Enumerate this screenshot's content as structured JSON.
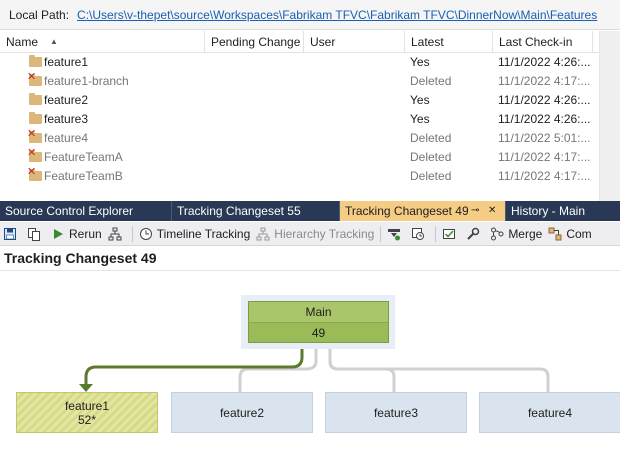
{
  "path_bar": {
    "label": "Local Path:",
    "path": "C:\\Users\\v-thepet\\source\\Workspaces\\Fabrikam TFVC\\Fabrikam TFVC\\DinnerNow\\Main\\Features"
  },
  "explorer": {
    "columns": [
      "Name",
      "Pending Change",
      "User",
      "Latest",
      "Last Check-in"
    ],
    "rows": [
      {
        "name": "feature1",
        "pending": "",
        "user": "",
        "latest": "Yes",
        "checkin": "11/1/2022 4:26:..."
      },
      {
        "name": "feature1-branch",
        "pending": "",
        "user": "",
        "latest": "Deleted",
        "checkin": "11/1/2022 4:17:..."
      },
      {
        "name": "feature2",
        "pending": "",
        "user": "",
        "latest": "Yes",
        "checkin": "11/1/2022 4:26:..."
      },
      {
        "name": "feature3",
        "pending": "",
        "user": "",
        "latest": "Yes",
        "checkin": "11/1/2022 4:26:..."
      },
      {
        "name": "feature4",
        "pending": "",
        "user": "",
        "latest": "Deleted",
        "checkin": "11/1/2022 5:01:..."
      },
      {
        "name": "FeatureTeamA",
        "pending": "",
        "user": "",
        "latest": "Deleted",
        "checkin": "11/1/2022 4:17:..."
      },
      {
        "name": "FeatureTeamB",
        "pending": "",
        "user": "",
        "latest": "Deleted",
        "checkin": "11/1/2022 4:17:..."
      }
    ]
  },
  "tabs": [
    {
      "label": "Source Control Explorer"
    },
    {
      "label": "Tracking Changeset 55"
    },
    {
      "label": "Tracking Changeset 49",
      "pin": "⊸",
      "close": "✕"
    },
    {
      "label": "History - Main"
    }
  ],
  "toolbar": {
    "rerun": "Rerun",
    "timeline": "Timeline Tracking",
    "hierarchy": "Hierarchy Tracking",
    "merge": "Merge",
    "compare": "Com"
  },
  "heading": "Tracking Changeset 49",
  "diagram": {
    "main": {
      "name": "Main",
      "changeset": "49"
    },
    "branches": [
      {
        "name": "feature1",
        "changeset": "52*"
      },
      {
        "name": "feature2",
        "changeset": ""
      },
      {
        "name": "feature3",
        "changeset": ""
      },
      {
        "name": "feature4",
        "changeset": ""
      }
    ]
  },
  "colors": {
    "tab_bar": "#293955",
    "tab_active": "#f5cc84",
    "main_node": "#9bbb59",
    "feature1_node": "#e3e6a3",
    "branch_node": "#d9e4ee",
    "link": "#1a5fb4",
    "connector_active": "#5b7a2e",
    "connector_inactive": "#d0d0d0"
  }
}
